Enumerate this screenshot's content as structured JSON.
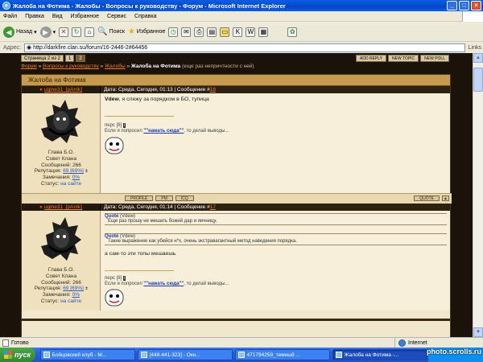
{
  "window": {
    "title": "Жалоба на Фотима - Жалобы - Вопросы к руководству - Форум - Microsoft Internet Explorer"
  },
  "menu": [
    "Файл",
    "Правка",
    "Вид",
    "Избранное",
    "Сервис",
    "Справка"
  ],
  "toolbar": {
    "back_label": "Назад",
    "search_label": "Поиск",
    "favorites_label": "Избранное"
  },
  "address": {
    "label": "Адрес:",
    "url": "http://darkfire.clan.su/forum/16-2446-2#64456",
    "links_label": "Links"
  },
  "pagination": {
    "label": "Страница 2 из",
    "total": "2",
    "pages": [
      "1",
      "2"
    ],
    "current": "2"
  },
  "topic_buttons": [
    "ADD REPLY",
    "NEW TOPIC",
    "NEW POLL"
  ],
  "breadcrumb": {
    "items": [
      "Форум",
      "Вопросы к руководству",
      "Жалобы"
    ],
    "separator": "»",
    "current": "Жалоба на Фотима",
    "subtitle": "(еще раз непричтности с ней)"
  },
  "forum_title": "Жалоба на Фотима",
  "posts": [
    {
      "author": "ugine31_[pAnIk]",
      "date": "Дата: Среда, Сегодня, 01:13",
      "msg_label": "Сообщение #",
      "msg_no": "16",
      "text_bold": "Vdew",
      "text": ", я слежу за порядком в БО, тупица",
      "rank": "Глава Б.О.",
      "group": "Совет Клана",
      "posts_count": "Сообщений: 266",
      "rep_label": "Репутация:",
      "rep_value": "69 [69%]",
      "warn_label": "Замечания:",
      "warn_value": "0%",
      "status_label": "Статус:",
      "status_value": "на сайте",
      "sig_line1": "перс [8]",
      "sig_line2_pre": "Если я попросил ",
      "sig_link": "\"\"нажать сюда\"\"",
      "sig_line2_post": ", то делай выводы..."
    },
    {
      "author": "ugine31_[pAnIk]",
      "date": "Дата: Среда, Сегодня, 01:14",
      "msg_label": "Сообщение #",
      "msg_no": "17",
      "quote1_label": "Quote",
      "quote1_author": "(Vdew)",
      "quote1_text": "Еще раз прошу не мешать божий дар и яичницу.",
      "quote2_label": "Quote",
      "quote2_author": "(Vdew)",
      "quote2_text": "Такие выражение как убейся н*х, очень экстравагантный метод наведения порядка.",
      "text": "а сам-то эти топы мешаешь",
      "rank": "Глава Б.О.",
      "group": "Совет Клана",
      "posts_count": "Сообщений: 266",
      "rep_label": "Репутация:",
      "rep_value": "69 [69%]",
      "warn_label": "Замечания:",
      "warn_value": "0%",
      "status_label": "Статус:",
      "status_value": "на сайте",
      "sig_line1": "перс [8]",
      "sig_line2_pre": "Если я попросил ",
      "sig_link": "\"\"нажать сюда\"\"",
      "sig_line2_post": ", то делай выводы..."
    }
  ],
  "post_buttons": [
    "PROFILE",
    "PM",
    "ICQ"
  ],
  "quote_button": "QUOTE",
  "status": {
    "text": "Готово",
    "zone": "Internet"
  },
  "taskbar": {
    "start": "пуск",
    "tasks": [
      "Бойцовский клуб - М...",
      "[448-441-323] - Окн...",
      "471794259_темный ...",
      "Жалоба на Фотима -..."
    ],
    "active_index": 3
  },
  "watermark": "photo.scrolls.ru"
}
